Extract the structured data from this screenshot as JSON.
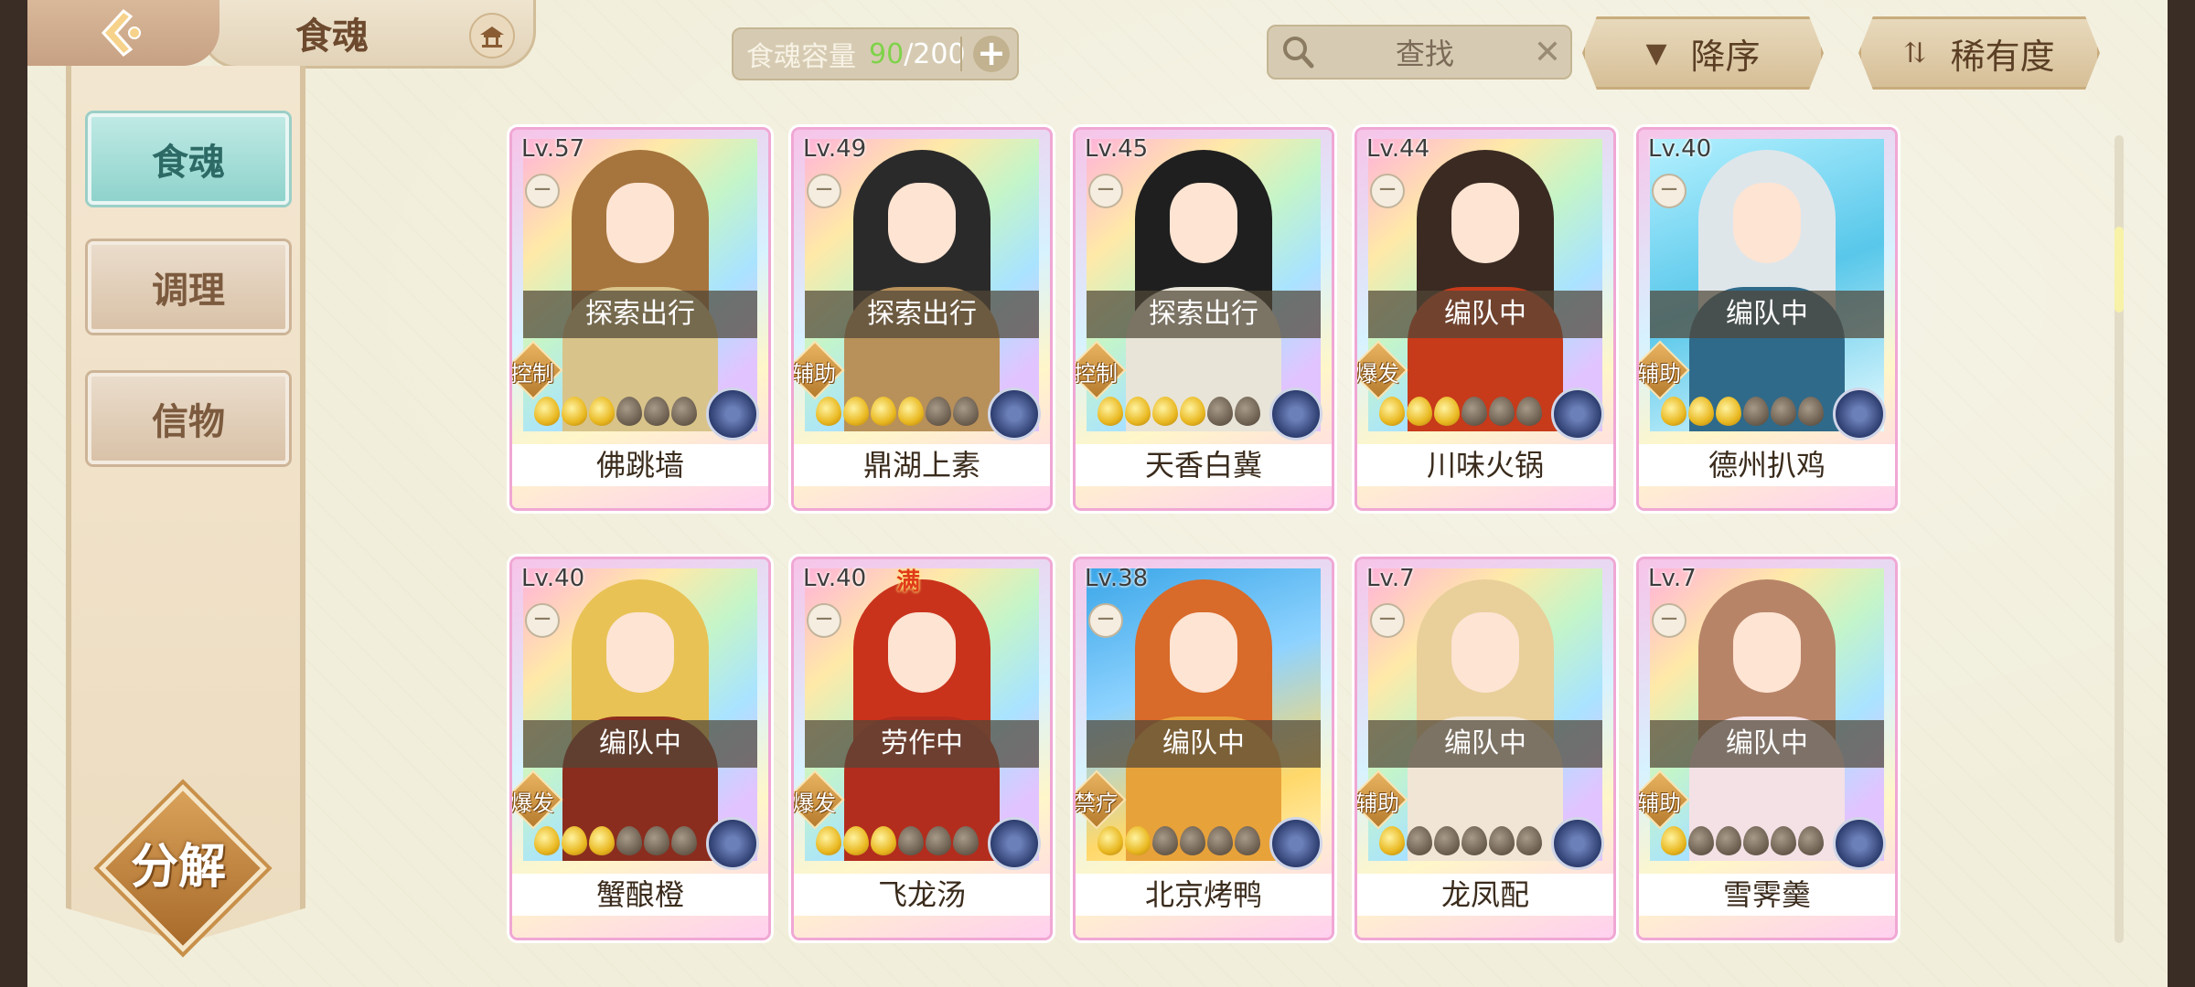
{
  "header": {
    "title": "食魂",
    "capacity_label": "食魂容量",
    "capacity_current": "90",
    "capacity_max": "/200",
    "search_placeholder": "查找",
    "sort_label": "降序",
    "rarity_label": "稀有度"
  },
  "sidebar": {
    "items": [
      {
        "label": "食魂",
        "active": true
      },
      {
        "label": "调理",
        "active": false
      },
      {
        "label": "信物",
        "active": false
      }
    ],
    "decompose_label": "分解"
  },
  "cards": [
    {
      "level": "Lv.57",
      "status": "探索出行",
      "role": "控制",
      "stars": 3,
      "name": "佛跳墙",
      "hair": "#a6743d",
      "outfit": "#d8c48a"
    },
    {
      "level": "Lv.49",
      "status": "探索出行",
      "role": "辅助",
      "stars": 4,
      "name": "鼎湖上素",
      "hair": "#2b2a2a",
      "outfit": "#b8905a"
    },
    {
      "level": "Lv.45",
      "status": "探索出行",
      "role": "控制",
      "stars": 4,
      "name": "天香白冀",
      "hair": "#1f1f1f",
      "outfit": "#e8e4d8"
    },
    {
      "level": "Lv.44",
      "status": "编队中",
      "role": "爆发",
      "stars": 3,
      "name": "川味火锅",
      "hair": "#3a2a22",
      "outfit": "#c73a1a"
    },
    {
      "level": "Lv.40",
      "status": "编队中",
      "role": "辅助",
      "stars": 3,
      "name": "德州扒鸡",
      "hair": "#dfe6ea",
      "outfit": "#2f6a8a"
    },
    {
      "level": "Lv.40",
      "status": "编队中",
      "role": "爆发",
      "stars": 3,
      "name": "蟹酿橙",
      "hair": "#e8c255",
      "outfit": "#8a2d1e"
    },
    {
      "level": "Lv.40",
      "status": "劳作中",
      "role": "爆发",
      "stars": 3,
      "name": "飞龙汤",
      "hair": "#c9331c",
      "outfit": "#b22d1d",
      "badge": "满"
    },
    {
      "level": "Lv.38",
      "status": "编队中",
      "role": "禁疗",
      "stars": 2,
      "name": "北京烤鸭",
      "hair": "#d86a2a",
      "outfit": "#e8a23a"
    },
    {
      "level": "Lv.7",
      "status": "编队中",
      "role": "辅助",
      "stars": 1,
      "name": "龙凤配",
      "hair": "#e9cf9a",
      "outfit": "#f1e6d6"
    },
    {
      "level": "Lv.7",
      "status": "编队中",
      "role": "辅助",
      "stars": 1,
      "name": "雪霁羹",
      "hair": "#b88468",
      "outfit": "#f3e1e6"
    }
  ]
}
